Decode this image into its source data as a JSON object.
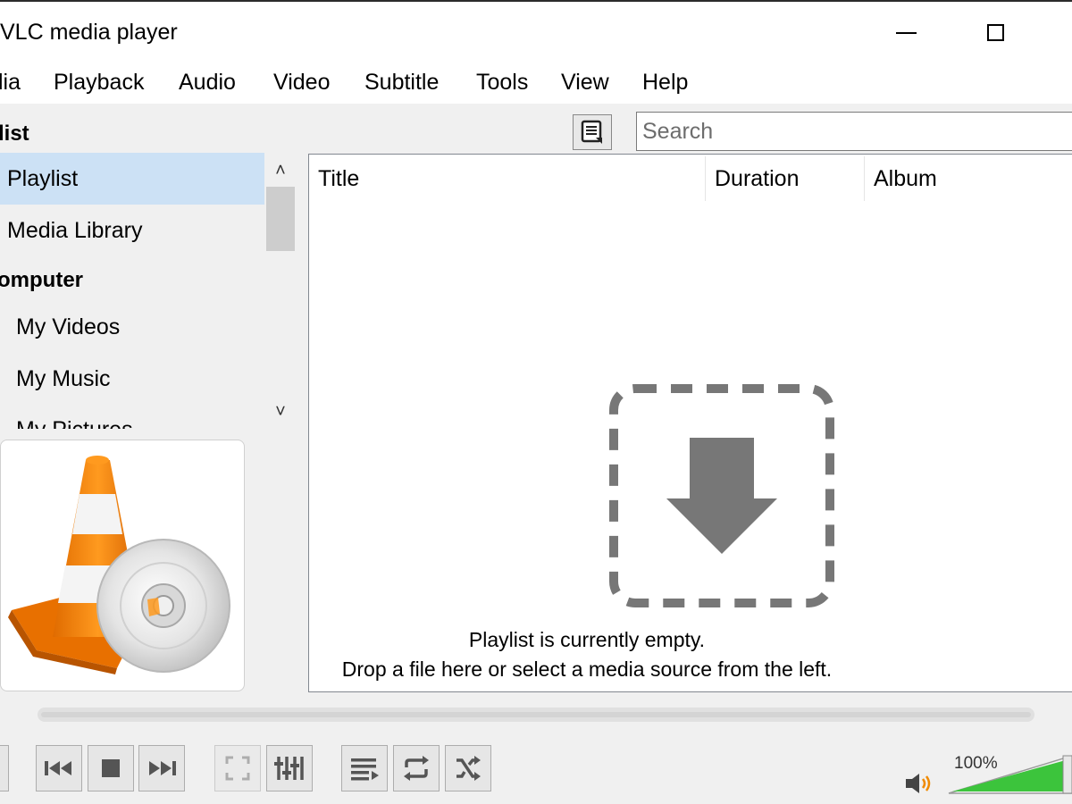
{
  "window": {
    "title": "VLC media player"
  },
  "menu": {
    "items": [
      "lia",
      "Playback",
      "Audio",
      "Video",
      "Subtitle",
      "Tools",
      "View",
      "Help"
    ]
  },
  "sidebar": {
    "header_playlist": "list",
    "items": [
      {
        "label": "Playlist",
        "selected": true
      },
      {
        "label": "Media Library",
        "selected": false
      }
    ],
    "header_computer": "omputer",
    "computer_items": [
      "My Videos",
      "My Music",
      "My Pictures"
    ]
  },
  "search": {
    "placeholder": "Search",
    "value": ""
  },
  "playlist": {
    "columns": [
      "Title",
      "Duration",
      "Album"
    ],
    "empty_line1": "Playlist is currently empty.",
    "empty_line2": "Drop a file here or select a media source from the left."
  },
  "controls": {
    "seek_progress": 0,
    "buttons": [
      "previous-icon",
      "stop-icon",
      "next-icon",
      "fullscreen-icon",
      "extended-settings-icon",
      "playlist-icon",
      "loop-icon",
      "shuffle-icon"
    ]
  },
  "volume": {
    "label": "100%",
    "level": 1.0
  },
  "colors": {
    "selection": "#cce1f5",
    "volume_green": "#3cc43c",
    "cone_orange": "#f07d00"
  }
}
